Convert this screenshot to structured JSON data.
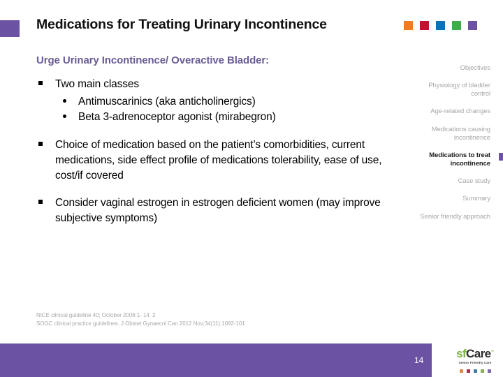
{
  "header": {
    "title": "Medications for Treating Urinary Incontinence",
    "accent_square_color": "#6B52A3",
    "dots": [
      {
        "name": "orange",
        "color": "#F07B22"
      },
      {
        "name": "crimson",
        "color": "#C2102E"
      },
      {
        "name": "blue",
        "color": "#0B72B5"
      },
      {
        "name": "green",
        "color": "#3FAE49"
      },
      {
        "name": "purple",
        "color": "#6B52A3"
      }
    ]
  },
  "subtitle": {
    "text": "Urge Urinary Incontinence/ Overactive Bladder:",
    "color": "#6B5B95"
  },
  "body": {
    "groups": [
      {
        "text": "Two main classes",
        "sub_items": [
          "Antimuscarinics (aka anticholinergics)",
          "Beta 3-adrenoceptor agonist (mirabegron)"
        ]
      },
      {
        "text": "Choice of medication based on the patient’s comorbidities, current medications, side effect profile of medications tolerability, ease of use, cost/if covered",
        "sub_items": []
      },
      {
        "text": "Consider vaginal estrogen in estrogen deficient women (may improve subjective symptoms)",
        "sub_items": []
      }
    ]
  },
  "side_nav": {
    "items": [
      {
        "label": "Objectives",
        "active": false
      },
      {
        "label": "Physiology of bladder control",
        "active": false
      },
      {
        "label": "Age-related changes",
        "active": false
      },
      {
        "label": "Medications causing incontinence",
        "active": false
      },
      {
        "label": "Medications to treat incontinence",
        "active": true
      },
      {
        "label": "Case study",
        "active": false
      },
      {
        "label": "Summary",
        "active": false
      },
      {
        "label": "Senior friendly approach",
        "active": false
      }
    ],
    "active_marker_color": "#6B52A3"
  },
  "citations": [
    "NICE clinical guideline 40; October 2006:1- 14. 2",
    "SOGC clinical practice guidelines. J Obstet Gynaecol Can 2012 Nov;34(11):1092-101"
  ],
  "footer": {
    "bar_color": "#6B52A3",
    "page_number": "14",
    "logo": {
      "prefix": "sf",
      "main": "Care",
      "trademark": "™",
      "tagline": "Senior Friendly Care",
      "dots": [
        {
          "name": "orange",
          "color": "#E08A4A"
        },
        {
          "name": "crimson",
          "color": "#A83248"
        },
        {
          "name": "blue",
          "color": "#3E7FA8"
        },
        {
          "name": "green",
          "color": "#8BAD5A"
        },
        {
          "name": "purple",
          "color": "#7D6AA8"
        }
      ]
    }
  }
}
